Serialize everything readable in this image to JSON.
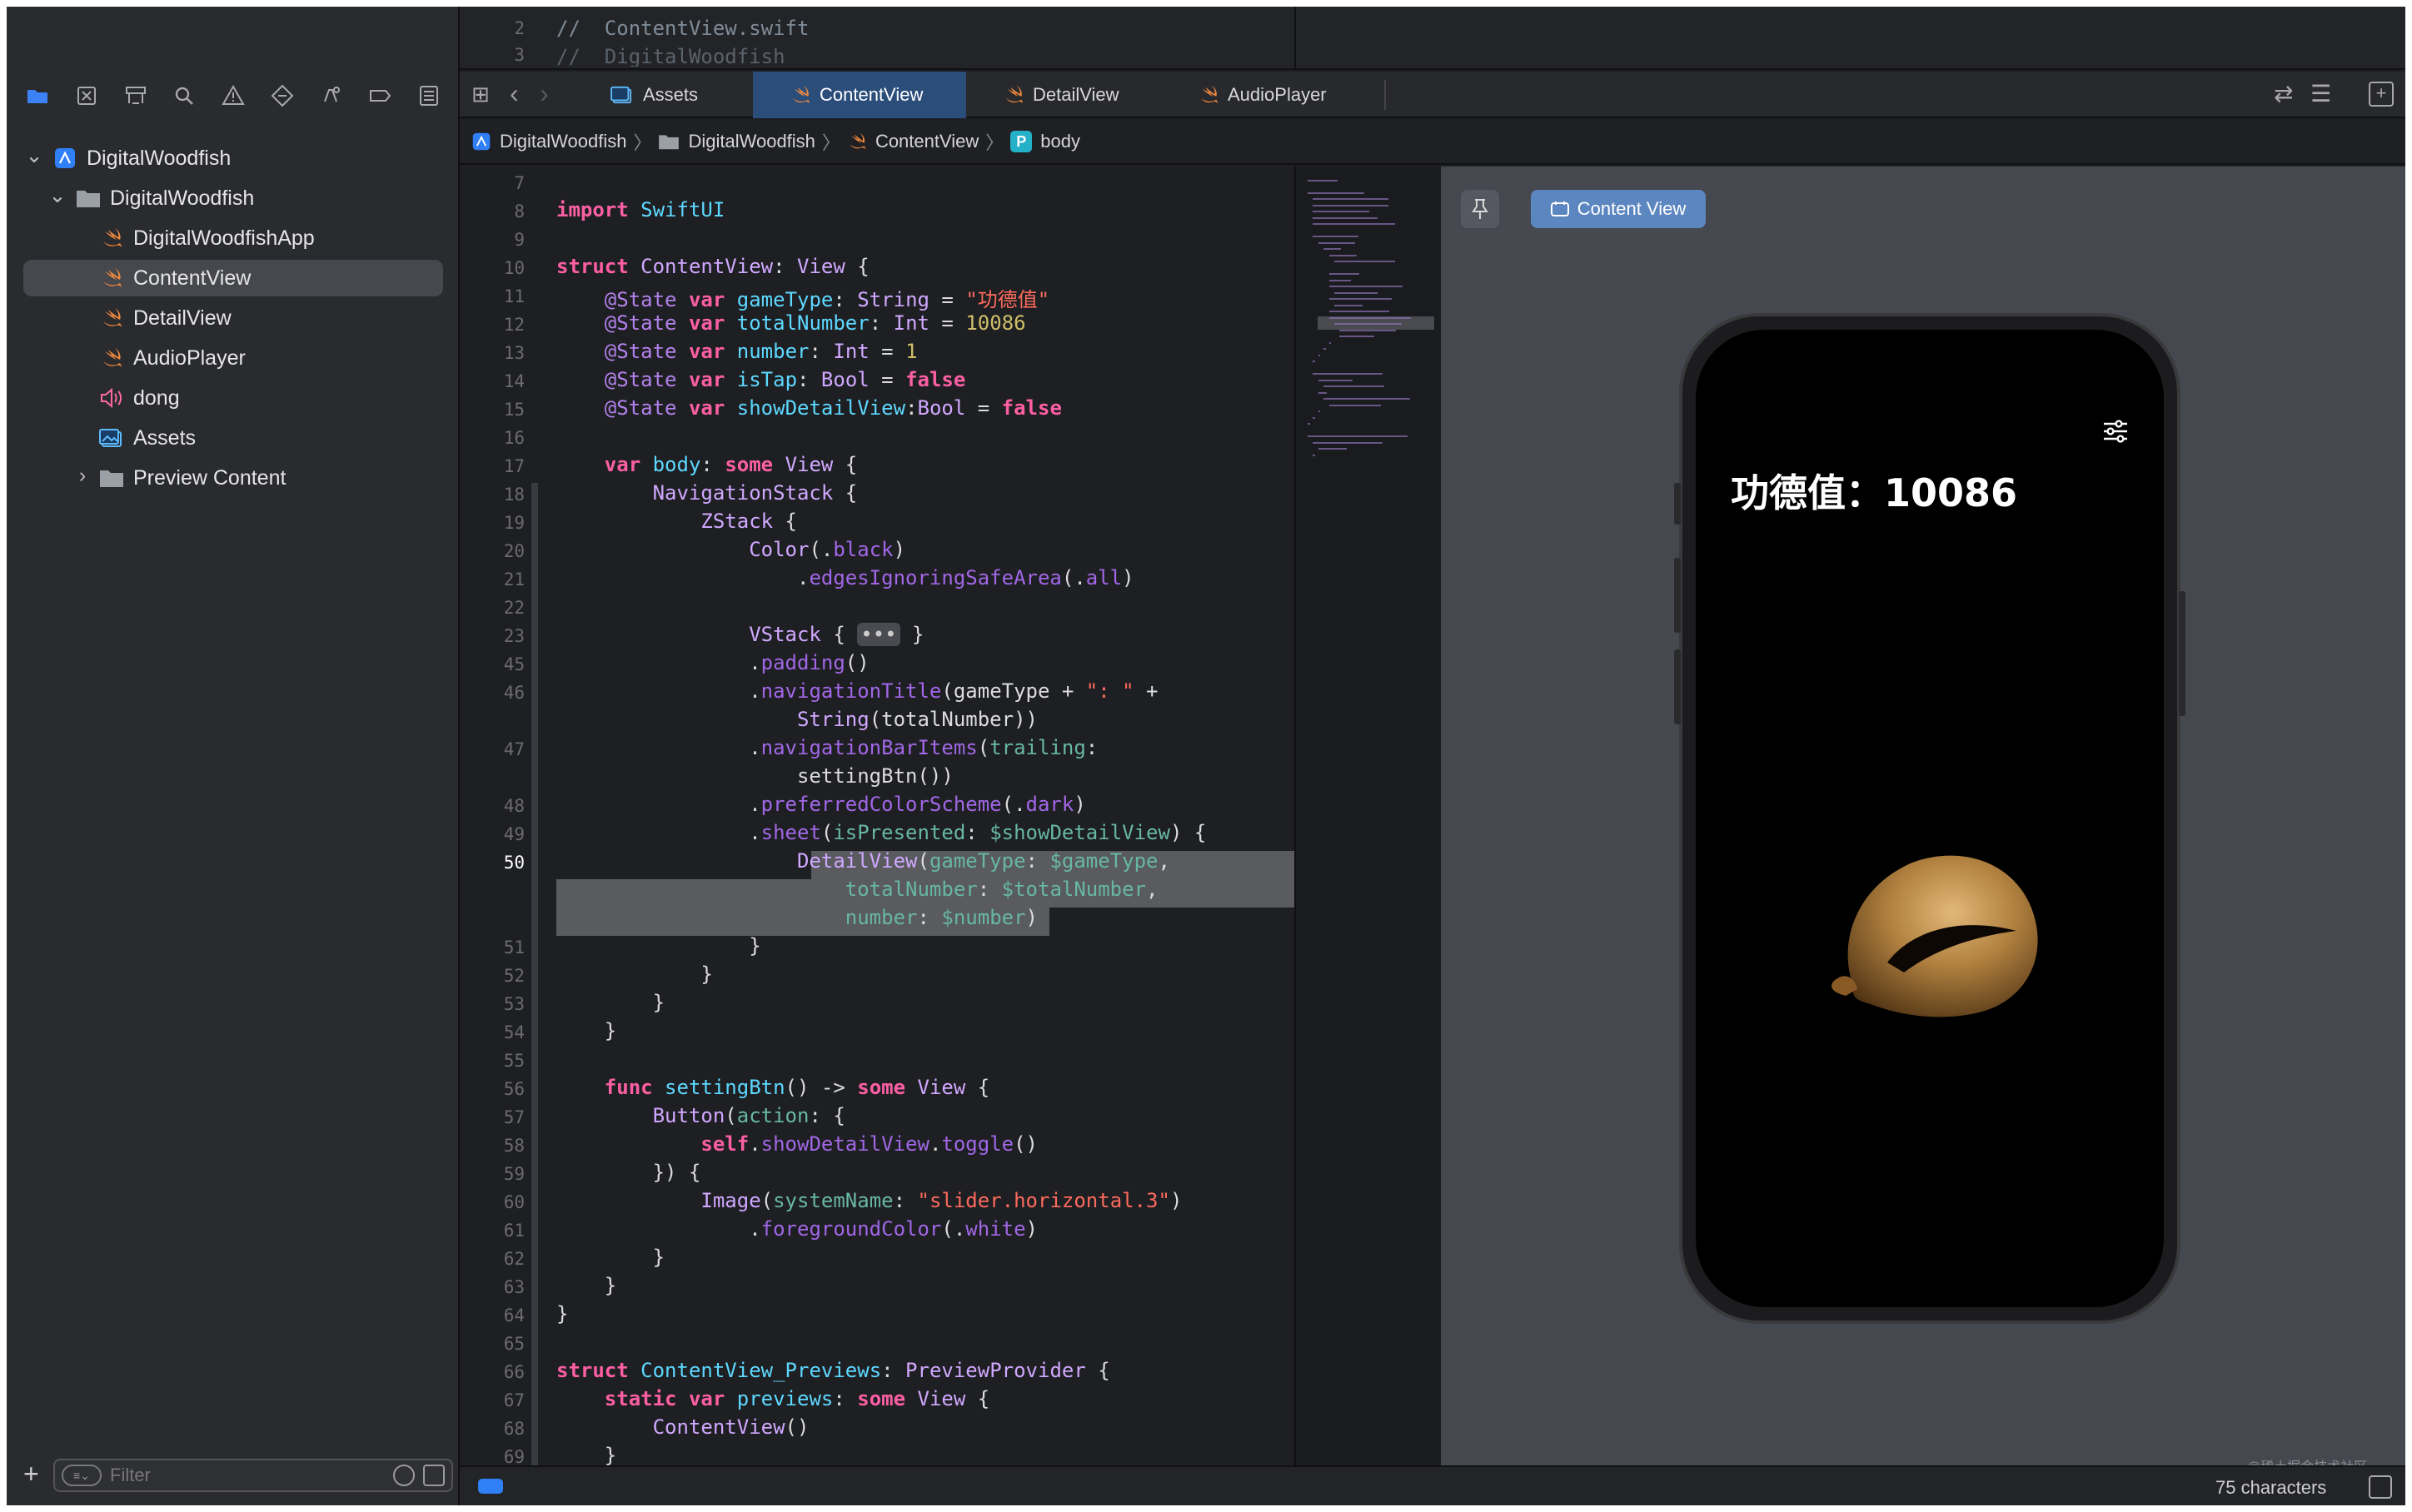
{
  "sidebar": {
    "tree": [
      {
        "label": "DigitalWoodfish",
        "kind": "project"
      },
      {
        "label": "DigitalWoodfish",
        "kind": "folder"
      },
      {
        "label": "DigitalWoodfishApp",
        "kind": "swift"
      },
      {
        "label": "ContentView",
        "kind": "swift"
      },
      {
        "label": "DetailView",
        "kind": "swift"
      },
      {
        "label": "AudioPlayer",
        "kind": "swift"
      },
      {
        "label": "dong",
        "kind": "audio"
      },
      {
        "label": "Assets",
        "kind": "assets"
      },
      {
        "label": "Preview Content",
        "kind": "folder"
      }
    ],
    "filter_placeholder": "Filter"
  },
  "topbar": {
    "peek_line_2": "2",
    "peek_line_3": "3",
    "peek_code_2": "//  ContentView.swift",
    "peek_code_3": "//  DigitalWoodfish"
  },
  "tabs": [
    {
      "label": "Assets"
    },
    {
      "label": "ContentView"
    },
    {
      "label": "DetailView"
    },
    {
      "label": "AudioPlayer"
    }
  ],
  "breadcrumb": [
    {
      "label": "DigitalWoodfish"
    },
    {
      "label": "DigitalWoodfish"
    },
    {
      "label": "ContentView"
    },
    {
      "label": "body",
      "badge": "P"
    }
  ],
  "code_lines": [
    {
      "n": "7",
      "t": ""
    },
    {
      "n": "8",
      "t": "import SwiftUI"
    },
    {
      "n": "9",
      "t": ""
    },
    {
      "n": "10",
      "t": "struct ContentView: View {"
    },
    {
      "n": "11",
      "t": "    @State var gameType: String = \"功德值\""
    },
    {
      "n": "12",
      "t": "    @State var totalNumber: Int = 10086"
    },
    {
      "n": "13",
      "t": "    @State var number: Int = 1"
    },
    {
      "n": "14",
      "t": "    @State var isTap: Bool = false"
    },
    {
      "n": "15",
      "t": "    @State var showDetailView:Bool = false"
    },
    {
      "n": "16",
      "t": ""
    },
    {
      "n": "17",
      "t": "    var body: some View {"
    },
    {
      "n": "18",
      "t": "        NavigationStack {"
    },
    {
      "n": "19",
      "t": "            ZStack {"
    },
    {
      "n": "20",
      "t": "                Color(.black)"
    },
    {
      "n": "21",
      "t": "                    .edgesIgnoringSafeArea(.all)"
    },
    {
      "n": "22",
      "t": ""
    },
    {
      "n": "23",
      "t": "                VStack { ••• }"
    },
    {
      "n": "45",
      "t": "                .padding()"
    },
    {
      "n": "46",
      "t": "                .navigationTitle(gameType + \": \" +"
    },
    {
      "n": "",
      "t": "                    String(totalNumber))"
    },
    {
      "n": "47",
      "t": "                .navigationBarItems(trailing:"
    },
    {
      "n": "",
      "t": "                    settingBtn())"
    },
    {
      "n": "48",
      "t": "                .preferredColorScheme(.dark)"
    },
    {
      "n": "49",
      "t": "                .sheet(isPresented: $showDetailView) {"
    },
    {
      "n": "50",
      "t": "                    DetailView(gameType: $gameType,"
    },
    {
      "n": "",
      "t": "                        totalNumber: $totalNumber,"
    },
    {
      "n": "",
      "t": "                        number: $number)"
    },
    {
      "n": "51",
      "t": "                }"
    },
    {
      "n": "52",
      "t": "            }"
    },
    {
      "n": "53",
      "t": "        }"
    },
    {
      "n": "54",
      "t": "    }"
    },
    {
      "n": "55",
      "t": ""
    },
    {
      "n": "56",
      "t": "    func settingBtn() -> some View {"
    },
    {
      "n": "57",
      "t": "        Button(action: {"
    },
    {
      "n": "58",
      "t": "            self.showDetailView.toggle()"
    },
    {
      "n": "59",
      "t": "        }) {"
    },
    {
      "n": "60",
      "t": "            Image(systemName: \"slider.horizontal.3\")"
    },
    {
      "n": "61",
      "t": "                .foregroundColor(.white)"
    },
    {
      "n": "62",
      "t": "        }"
    },
    {
      "n": "63",
      "t": "    }"
    },
    {
      "n": "64",
      "t": "}"
    },
    {
      "n": "65",
      "t": ""
    },
    {
      "n": "66",
      "t": "struct ContentView_Previews: PreviewProvider {"
    },
    {
      "n": "67",
      "t": "    static var previews: some View {"
    },
    {
      "n": "68",
      "t": "        ContentView()"
    },
    {
      "n": "69",
      "t": "    }"
    }
  ],
  "preview": {
    "pin_button": "pin",
    "content_view_chip": "Content View",
    "phone_title": "功德值：10086",
    "watermark": "@稀土掘金技术社区"
  },
  "status": {
    "characters": "75 characters"
  },
  "colors": {
    "accent": "#2a4d7a",
    "swift": "#f0883e",
    "folder": "#9aa0a6",
    "project": "#3b82f6"
  }
}
